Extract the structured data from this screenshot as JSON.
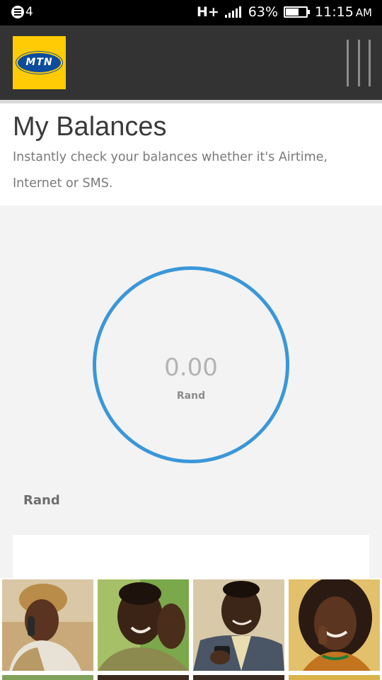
{
  "status_bar": {
    "notification_count": "4",
    "network_type": "H+",
    "battery_percent": "63%",
    "battery_level": 0.63,
    "time": "11:15",
    "time_suffix": "AM",
    "icons": [
      "notification-icon",
      "signal-icon",
      "battery-icon"
    ]
  },
  "header": {
    "logo_text": "MTN",
    "menu_icon": "vertical-lines-menu-icon",
    "colors": {
      "bar": "#333333",
      "logo_yellow": "#ffcb05",
      "logo_blue": "#0b4d9c"
    }
  },
  "page": {
    "title": "My Balances",
    "subtitle": "Instantly check your balances whether it's Airtime, Internet or SMS."
  },
  "balance": {
    "amount": "0.00",
    "unit": "Rand",
    "ring_color": "#3a97d8"
  },
  "section": {
    "label": "Rand"
  },
  "photos": [
    "woman-on-phone-photo",
    "smiling-man-photo",
    "man-with-phone-photo",
    "smiling-woman-photo"
  ]
}
